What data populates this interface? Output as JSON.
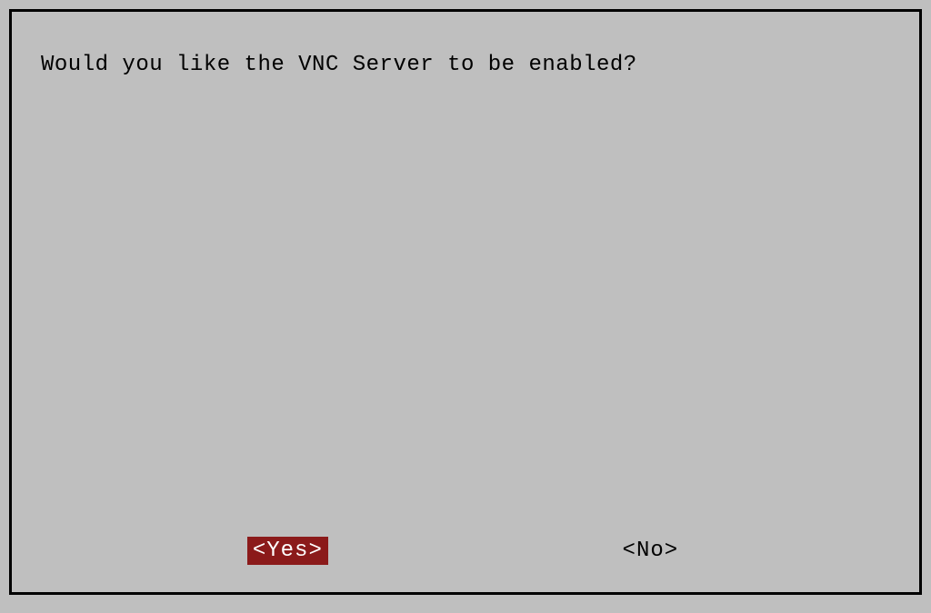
{
  "dialog": {
    "prompt": "Would you like the VNC Server to be enabled?",
    "buttons": {
      "yes": "<Yes>",
      "no": "<No>"
    }
  }
}
